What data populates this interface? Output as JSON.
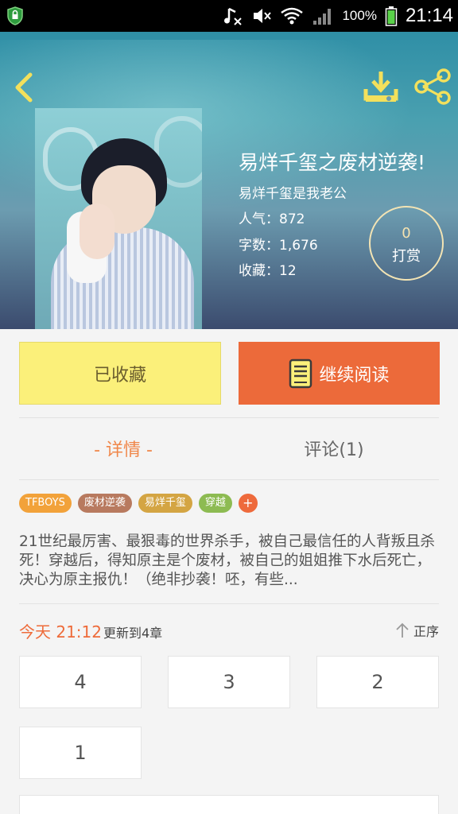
{
  "status_bar": {
    "battery_percent": "100%",
    "time": "21:14",
    "icons": [
      "shield-icon",
      "music-muted-icon",
      "volume-muted-icon",
      "wifi-icon",
      "signal-icon",
      "battery-icon"
    ]
  },
  "header": {
    "icons": [
      "back-arrow-icon",
      "download-icon",
      "share-icon"
    ]
  },
  "book": {
    "title": "易烊千玺之废材逆袭!",
    "author": "易烊千玺是我老公",
    "popularity": "人气：872",
    "word_count": "字数：1,676",
    "favorites": "收藏：12",
    "tip_count": "0",
    "tip_label": "打赏"
  },
  "actions": {
    "favorited_label": "已收藏",
    "continue_label": "继续阅读"
  },
  "tabs": {
    "detail": "- 详情 -",
    "comments": "评论(1)"
  },
  "tags": [
    {
      "label": "TFBOYS",
      "color": "#f2a23a"
    },
    {
      "label": "废材逆袭",
      "color": "#b87a5f"
    },
    {
      "label": "易烊千玺",
      "color": "#d4a543"
    },
    {
      "label": "穿越",
      "color": "#8dbb52"
    }
  ],
  "tag_add_label": "+",
  "description": "21世纪最厉害、最狠毒的世界杀手，被自己最信任的人背叛且杀死！穿越后，得知原主是个废材，被自己的姐姐推下水后死亡，决心为原主报仇！（绝非抄袭！呸，有些...",
  "update": {
    "time": "今天 21:12",
    "text": "更新到4章",
    "order_label": "正序"
  },
  "chapters": [
    "4",
    "3",
    "2",
    "1"
  ],
  "colors": {
    "accent_orange": "#ec6a3a",
    "favorited_yellow": "#fbf07a",
    "tab_active": "#f0874a"
  }
}
